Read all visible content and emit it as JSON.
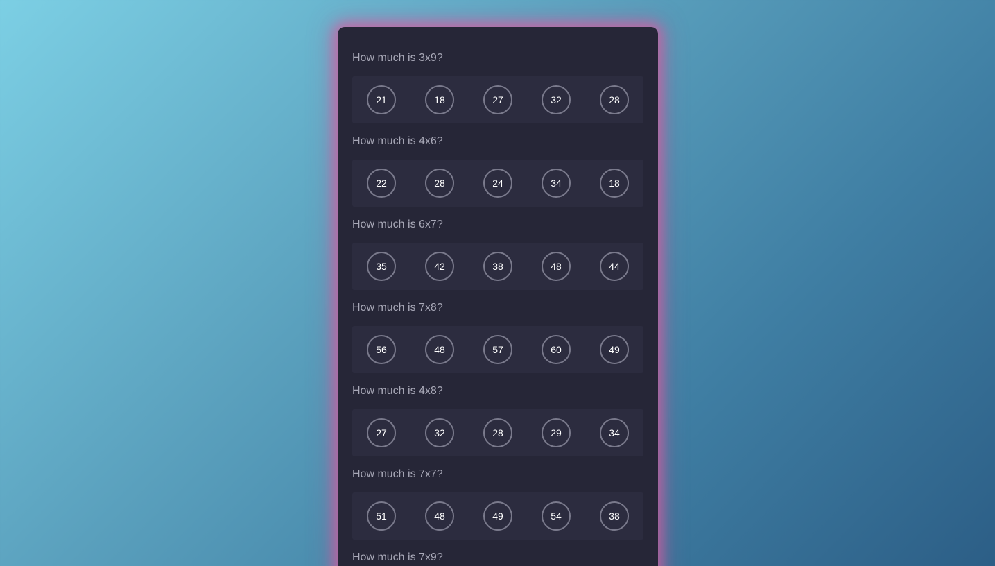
{
  "questions": [
    {
      "text": "How much is 3x9?",
      "options": [
        "21",
        "18",
        "27",
        "32",
        "28"
      ]
    },
    {
      "text": "How much is 4x6?",
      "options": [
        "22",
        "28",
        "24",
        "34",
        "18"
      ]
    },
    {
      "text": "How much is 6x7?",
      "options": [
        "35",
        "42",
        "38",
        "48",
        "44"
      ]
    },
    {
      "text": "How much is 7x8?",
      "options": [
        "56",
        "48",
        "57",
        "60",
        "49"
      ]
    },
    {
      "text": "How much is 4x8?",
      "options": [
        "27",
        "32",
        "28",
        "29",
        "34"
      ]
    },
    {
      "text": "How much is 7x7?",
      "options": [
        "51",
        "48",
        "49",
        "54",
        "38"
      ]
    },
    {
      "text": "How much is 7x9?",
      "options": []
    }
  ]
}
